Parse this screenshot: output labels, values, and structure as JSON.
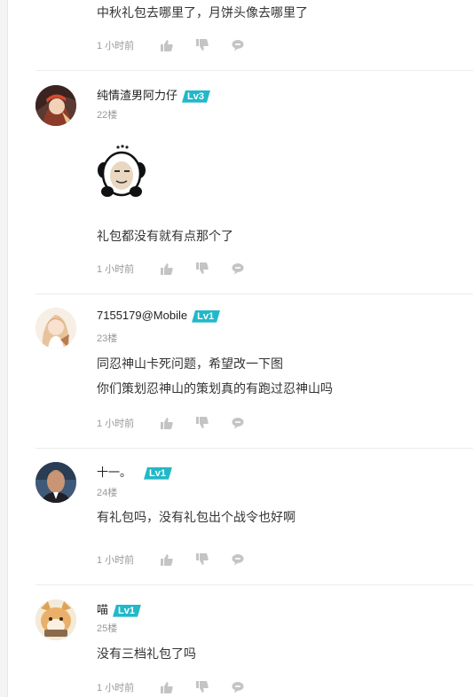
{
  "comments": [
    {
      "text_lines": [
        "中秋礼包去哪里了，月饼头像去哪里了"
      ],
      "time": "1 小时前"
    },
    {
      "username": "纯情渣男阿力仔",
      "level": "Lv3",
      "floor": "22楼",
      "sticker": "panda-meme-sticker",
      "text_lines": [
        "礼包都没有就有点那个了"
      ],
      "time": "1 小时前"
    },
    {
      "username": "7155179@Mobile",
      "level": "Lv1",
      "floor": "23楼",
      "text_lines": [
        "同忍神山卡死问题，希望改一下图",
        "你们策划忍神山的策划真的有跑过忍神山吗"
      ],
      "time": "1 小时前"
    },
    {
      "username": "十一。",
      "level": "Lv1",
      "floor": "24楼",
      "text_lines": [
        "有礼包吗，没有礼包出个战令也好啊"
      ],
      "time": "1 小时前"
    },
    {
      "username": "喵",
      "level": "Lv1",
      "floor": "25楼",
      "text_lines": [
        "没有三档礼包了吗"
      ],
      "time": "1 小时前"
    }
  ],
  "icons": {
    "like": "thumb-up-icon",
    "dislike": "thumb-down-icon",
    "reply": "comment-bubble-icon"
  },
  "colors": {
    "level_badge": "#22b8c9",
    "icon_gray": "#c4c4c4",
    "meta_text": "#999999"
  }
}
